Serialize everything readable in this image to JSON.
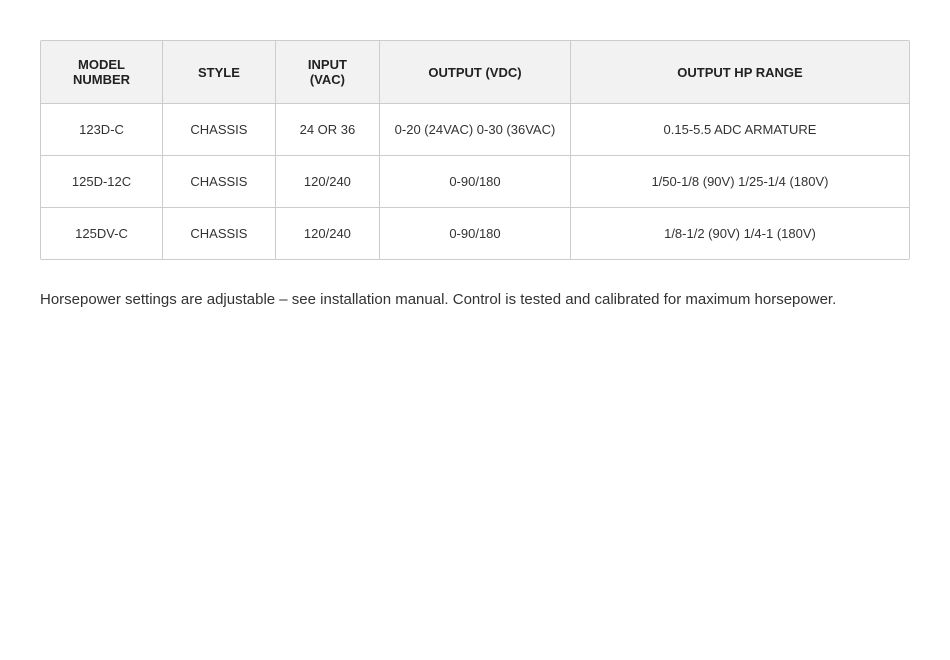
{
  "table": {
    "headers": [
      {
        "id": "model-number",
        "label": "MODEL\nNUMBER"
      },
      {
        "id": "style",
        "label": "STYLE"
      },
      {
        "id": "input-vac",
        "label": "INPUT\n(VAC)"
      },
      {
        "id": "output-vdc",
        "label": "OUTPUT (VDC)"
      },
      {
        "id": "output-hp",
        "label": "OUTPUT HP RANGE"
      }
    ],
    "rows": [
      {
        "model": "123D-C",
        "style": "CHASSIS",
        "input": "24 OR 36",
        "output": "0-20 (24VAC) 0-30 (36VAC)",
        "hp": "0.15-5.5 ADC ARMATURE"
      },
      {
        "model": "125D-12C",
        "style": "CHASSIS",
        "input": "120/240",
        "output": "0-90/180",
        "hp": "1/50-1/8 (90V) 1/25-1/4 (180V)"
      },
      {
        "model": "125DV-C",
        "style": "CHASSIS",
        "input": "120/240",
        "output": "0-90/180",
        "hp": "1/8-1/2 (90V) 1/4-1 (180V)"
      }
    ]
  },
  "footnote": "Horsepower settings are adjustable – see installation manual. Control is tested and calibrated for maximum horsepower."
}
